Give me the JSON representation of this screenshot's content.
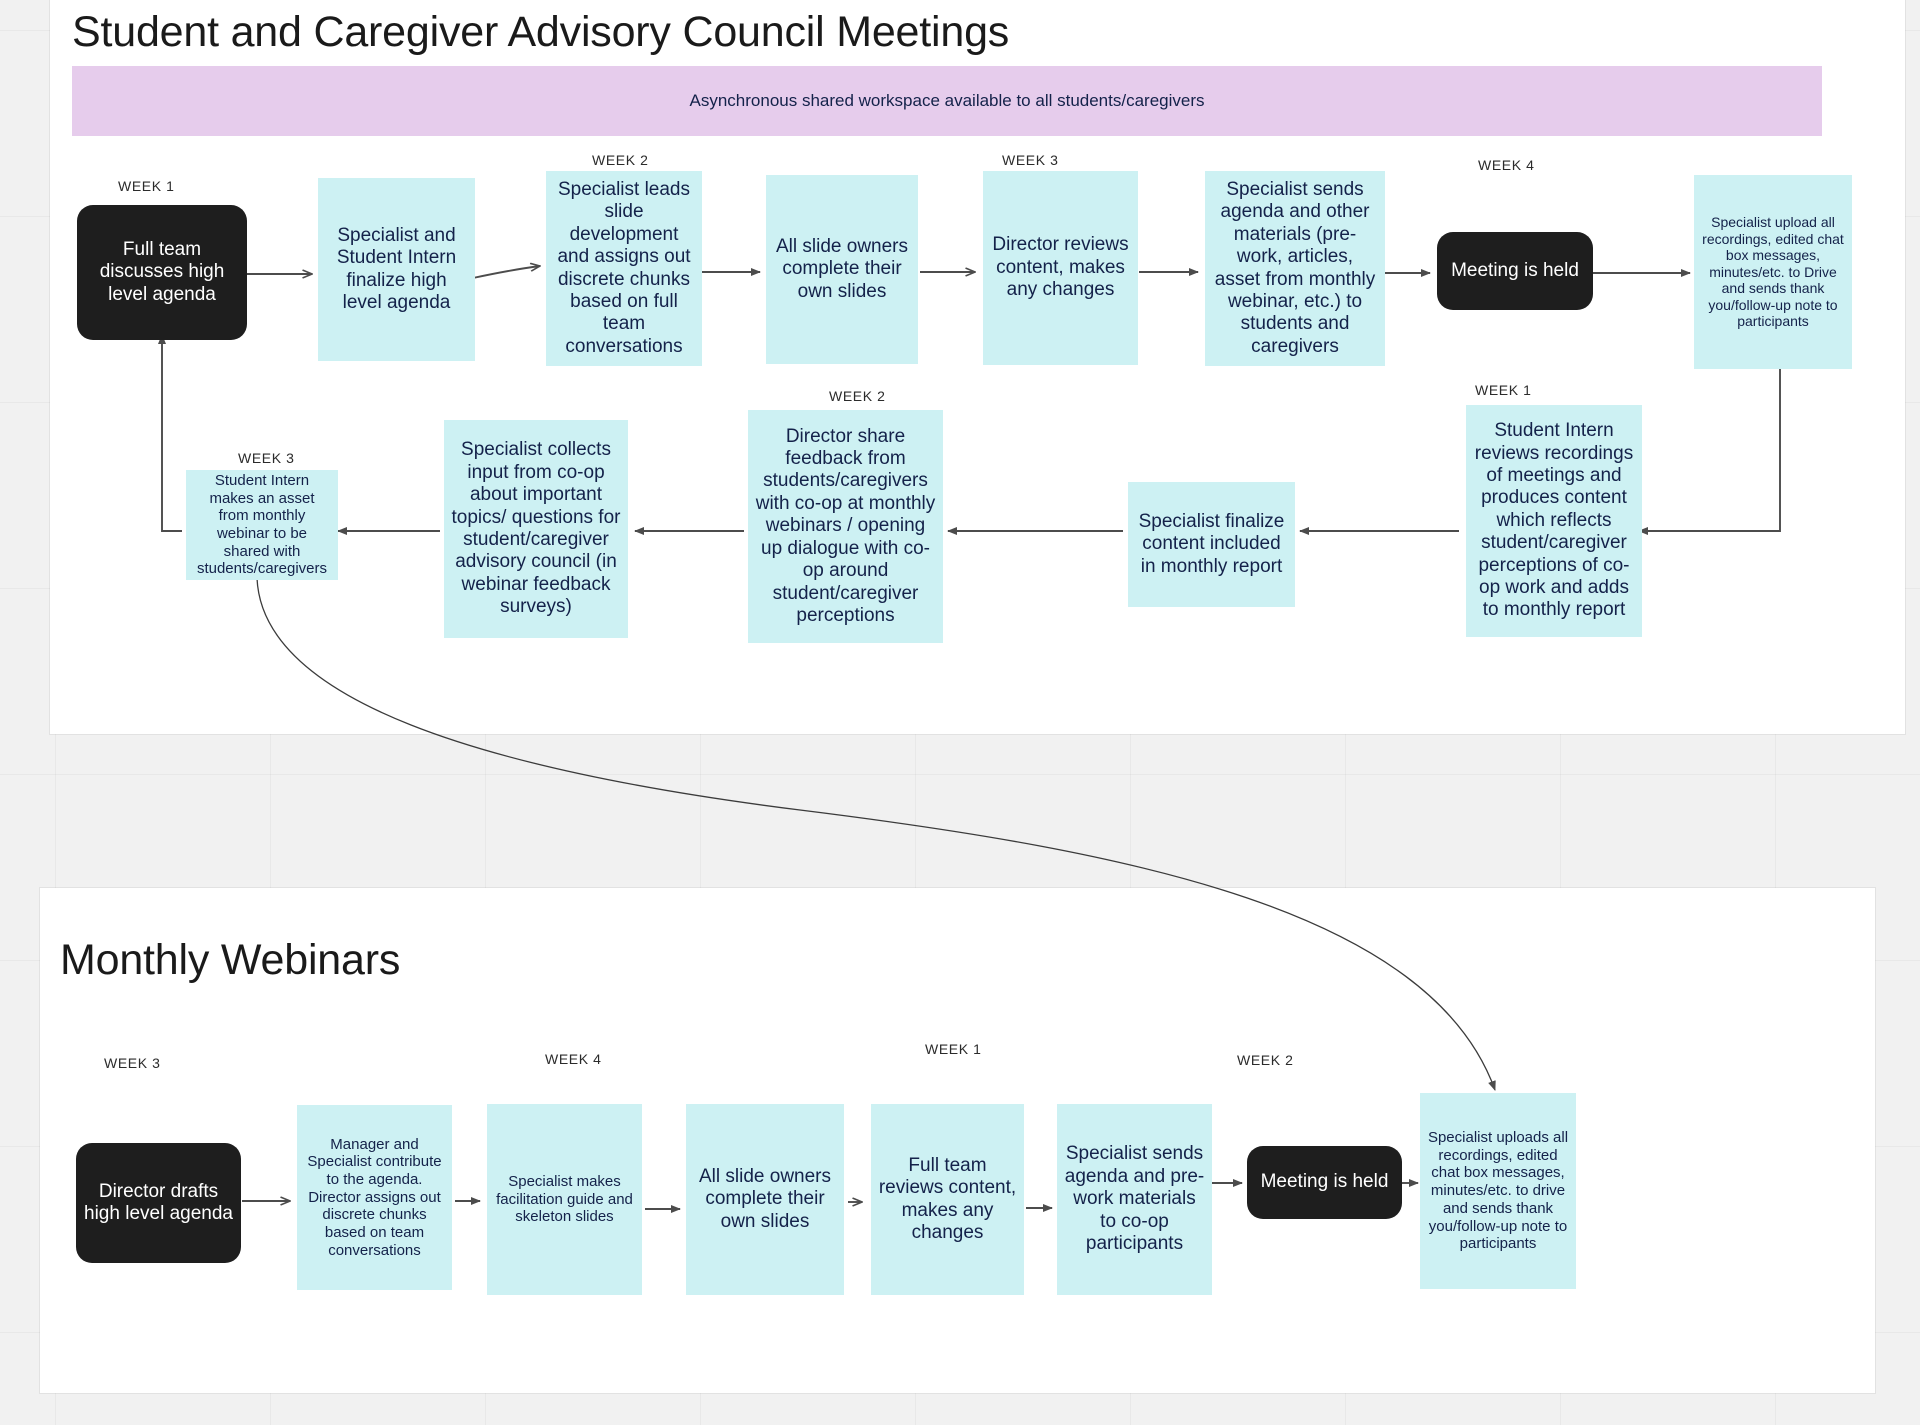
{
  "canvas": {
    "background_color": "#f1f1f1",
    "panel_color": "#ffffff",
    "node_cyan": "#cdf1f3",
    "node_dark": "#1e1e1e",
    "banner_color": "#e6ccec",
    "text_color": "#14224a"
  },
  "sections": {
    "council": {
      "title": "Student and Caregiver Advisory Council Meetings",
      "banner": "Asynchronous shared workspace available to all students/caregivers"
    },
    "webinars": {
      "title": "Monthly Webinars"
    }
  },
  "council_row1": {
    "week_labels": [
      {
        "text": "WEEK 1"
      },
      {
        "text": "WEEK 2"
      },
      {
        "text": "WEEK 3"
      },
      {
        "text": "WEEK 4"
      }
    ],
    "nodes": [
      {
        "id": "c1",
        "text": "Full team discusses high level agenda",
        "style": "dark",
        "week": "WEEK 1"
      },
      {
        "id": "c2",
        "text": "Specialist and Student Intern finalize high level agenda",
        "style": "cyan",
        "week": ""
      },
      {
        "id": "c3",
        "text": "Specialist leads slide development and assigns out discrete chunks based on full team conversations",
        "style": "cyan",
        "week": "WEEK 2"
      },
      {
        "id": "c4",
        "text": "All slide owners complete their own slides",
        "style": "cyan",
        "week": ""
      },
      {
        "id": "c5",
        "text": "Director reviews content, makes any changes",
        "style": "cyan",
        "week": "WEEK 3"
      },
      {
        "id": "c6",
        "text": "Specialist sends agenda and other materials (pre-work, articles, asset from monthly webinar, etc.) to students and caregivers",
        "style": "cyan",
        "week": ""
      },
      {
        "id": "c7",
        "text": "Meeting is held",
        "style": "dark",
        "week": "WEEK 4"
      },
      {
        "id": "c8",
        "text": "Specialist upload all recordings, edited chat box messages, minutes/etc. to Drive and sends thank you/follow-up note to participants",
        "style": "cyan",
        "week": ""
      }
    ]
  },
  "council_row2": {
    "week_labels": [
      {
        "text": "WEEK 3"
      },
      {
        "text": "WEEK 2"
      },
      {
        "text": "WEEK 1"
      }
    ],
    "nodes": [
      {
        "id": "c9",
        "text": "Student Intern reviews recordings of meetings and produces content which reflects student/caregiver perceptions of co-op work and adds to monthly report",
        "style": "cyan",
        "week": "WEEK 1"
      },
      {
        "id": "c10",
        "text": "Specialist finalize content included in monthly report",
        "style": "cyan",
        "week": ""
      },
      {
        "id": "c11",
        "text": "Director share feedback from students/caregivers with co-op at monthly webinars / opening up dialogue with co-op around student/caregiver perceptions",
        "style": "cyan",
        "week": "WEEK 2"
      },
      {
        "id": "c12",
        "text": "Specialist collects input from co-op about important topics/ questions for student/caregiver advisory council (in webinar feedback surveys)",
        "style": "cyan",
        "week": ""
      },
      {
        "id": "c13",
        "text": "Student Intern makes an asset from monthly webinar to be shared with students/caregivers",
        "style": "cyan",
        "week": "WEEK 3"
      }
    ]
  },
  "webinar_row": {
    "week_labels": [
      {
        "text": "WEEK 3"
      },
      {
        "text": "WEEK 4"
      },
      {
        "text": "WEEK 1"
      },
      {
        "text": "WEEK 2"
      }
    ],
    "nodes": [
      {
        "id": "w1",
        "text": "Director drafts high level agenda",
        "style": "dark",
        "week": "WEEK 3"
      },
      {
        "id": "w2",
        "text": "Manager  and Specialist contribute to the agenda. Director assigns out discrete chunks based on  team conversations",
        "style": "cyan",
        "week": ""
      },
      {
        "id": "w3",
        "text": "Specialist makes facilitation guide and skeleton slides",
        "style": "cyan",
        "week": "WEEK 4"
      },
      {
        "id": "w4",
        "text": "All slide owners complete their own slides",
        "style": "cyan",
        "week": ""
      },
      {
        "id": "w5",
        "text": "Full team reviews content, makes any changes",
        "style": "cyan",
        "week": "WEEK 1"
      },
      {
        "id": "w6",
        "text": "Specialist sends agenda and pre-work materials to co-op participants",
        "style": "cyan",
        "week": ""
      },
      {
        "id": "w7",
        "text": "Meeting is held",
        "style": "dark",
        "week": "WEEK 2"
      },
      {
        "id": "w8",
        "text": "Specialist uploads all recordings, edited chat box messages, minutes/etc. to drive and sends thank you/follow-up note to participants",
        "style": "cyan",
        "week": ""
      }
    ]
  }
}
